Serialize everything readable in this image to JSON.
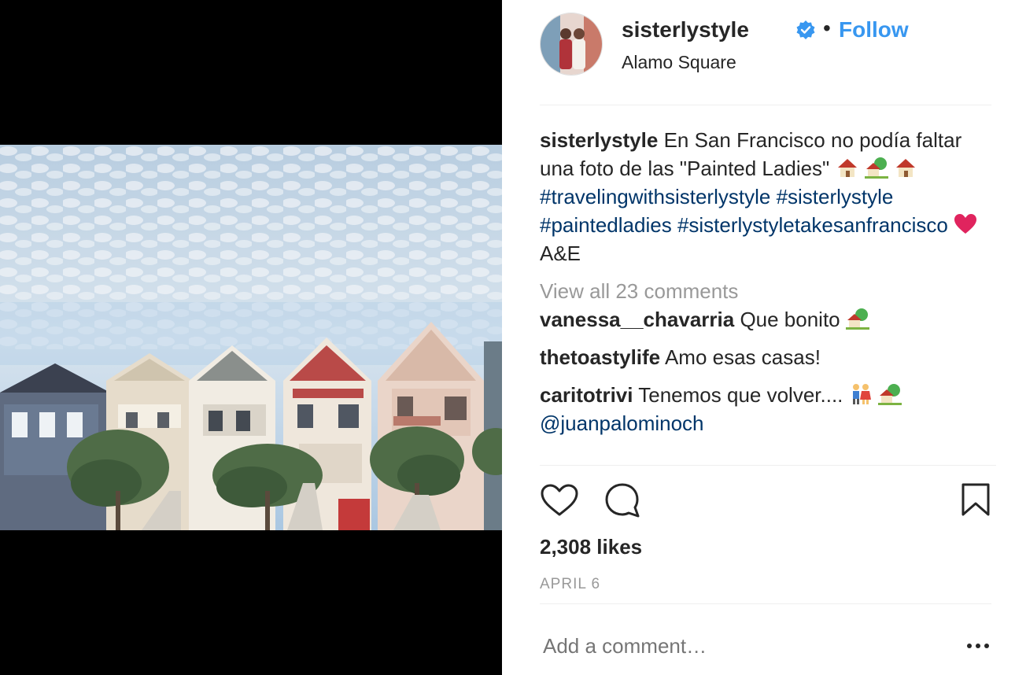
{
  "post": {
    "username": "sisterlystyle",
    "follow_label": "Follow",
    "location": "Alamo Square",
    "dot": "•",
    "caption_user": "sisterlystyle",
    "caption_text1": "En San Francisco no podía faltar una foto de las \"Painted Ladies\"",
    "hashtags": [
      "#travelingwithsisterlystyle",
      "#sisterlystyle",
      "#paintedladies",
      "#sisterlystyletakesanfrancisco"
    ],
    "caption_tail": "A&E",
    "view_all": "View all 23 comments",
    "comments": [
      {
        "user": "vanessa__chavarria",
        "text": "Que bonito"
      },
      {
        "user": "thetoastylife",
        "text": "Amo esas casas!"
      },
      {
        "user": "caritotrivi",
        "text": "Tenemos que volver....",
        "mention": "@juanpalominoch"
      }
    ],
    "likes": "2,308 likes",
    "date": "APRIL 6",
    "add_comment_placeholder": "Add a comment…",
    "icons": [
      "heart-icon",
      "comment-icon",
      "bookmark-icon",
      "more-icon",
      "verified-badge-icon"
    ],
    "colors": {
      "link": "#3897f0",
      "hashtag": "#003569",
      "muted": "#999999",
      "verified": "#3897f0"
    }
  }
}
